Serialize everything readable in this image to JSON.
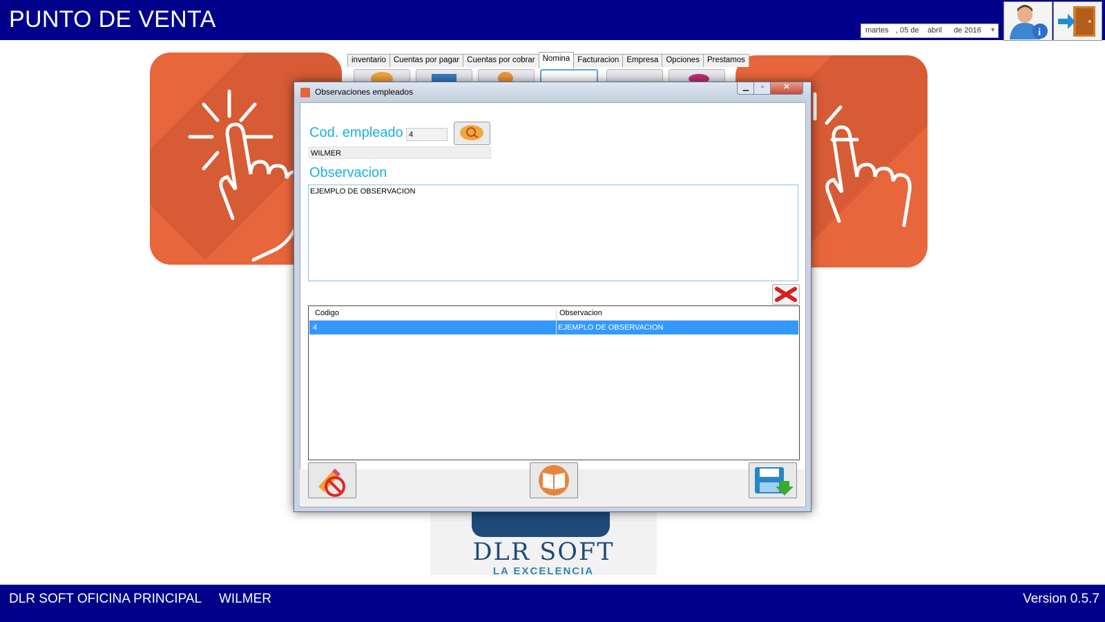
{
  "app": {
    "title": "PUNTO DE VENTA"
  },
  "date_picker": {
    "weekday": "martes",
    "day": ", 05 de",
    "month": "abril",
    "year": "de 2016"
  },
  "tabs": [
    "inventario",
    "Cuentas por pagar",
    "Cuentas por cobrar",
    "Nomina",
    "Facturacion",
    "Empresa",
    "Opciones",
    "Prestamos"
  ],
  "active_tab": "Nomina",
  "dialog": {
    "title": "Observaciones empleados",
    "cod_label": "Cod. empleado",
    "cod_value": "4",
    "employee_name": "WILMER",
    "obs_label": "Observacion",
    "obs_value": "EJEMPLO DE OBSERVACION",
    "grid": {
      "headers": [
        "Codigo",
        "Observacion"
      ],
      "rows": [
        {
          "codigo": "4",
          "observacion": "EJEMPLO DE OBSERVACION"
        }
      ]
    }
  },
  "logo": {
    "title": "DLR SOFT",
    "subtitle": "LA EXCELENCIA"
  },
  "status": {
    "branch": "DLR SOFT OFICINA PRINCIPAL",
    "user": "WILMER",
    "version": "Version 0.5.7"
  },
  "colors": {
    "header_bg": "#00008b",
    "tile": "#e8663c",
    "accent_label": "#1ab0e3",
    "selection": "#3399ff"
  },
  "icons": [
    "user-info-icon",
    "exit-door-icon",
    "search-icon",
    "delete-x-icon",
    "cancel-edit-icon",
    "open-book-icon",
    "save-disk-icon",
    "tap-hand-icon"
  ]
}
